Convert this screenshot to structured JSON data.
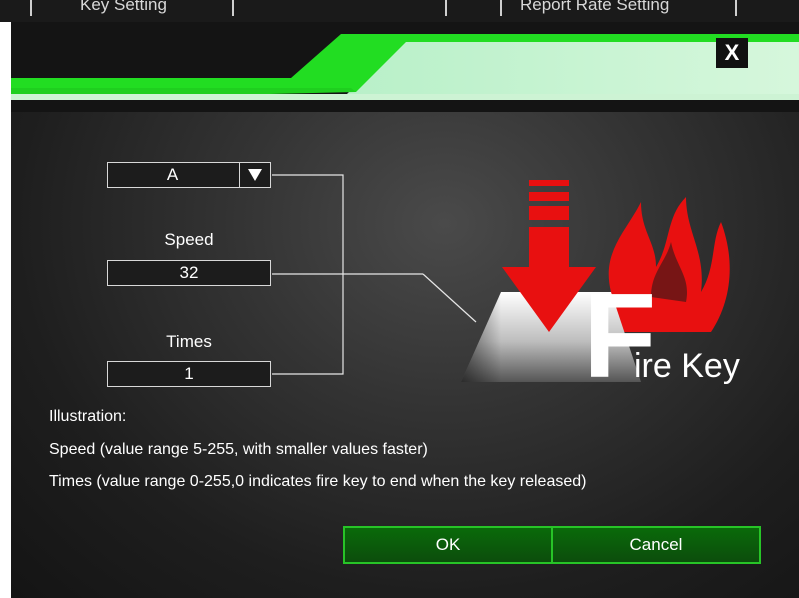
{
  "background_window": {
    "tabs": [
      "Key Setting",
      "Report Rate Setting"
    ]
  },
  "dialog": {
    "close_label": "X",
    "key_select": {
      "value": "A"
    },
    "speed": {
      "label": "Speed",
      "value": "32"
    },
    "times": {
      "label": "Times",
      "value": "1"
    },
    "logo": {
      "letter": "F",
      "text": "ire Key"
    },
    "illustration": {
      "heading": "Illustration:",
      "line1": "Speed (value range 5-255, with smaller values faster)",
      "line2": "Times (value range 0-255,0 indicates fire key to end when the key released)"
    },
    "ok_label": "OK",
    "cancel_label": "Cancel"
  },
  "colors": {
    "accent_green": "#22dd22",
    "button_border": "#27c427",
    "arrow_red": "#e81010"
  }
}
